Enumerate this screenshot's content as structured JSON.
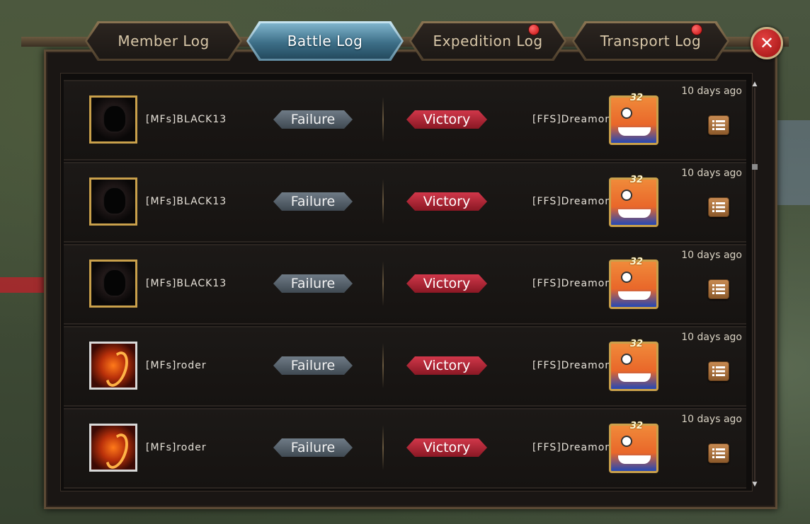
{
  "tabs": [
    {
      "label": "Member Log",
      "active": false,
      "notification": false
    },
    {
      "label": "Battle Log",
      "active": true,
      "notification": false
    },
    {
      "label": "Expedition Log",
      "active": false,
      "notification": true
    },
    {
      "label": "Transport Log",
      "active": false,
      "notification": true
    }
  ],
  "close_label": "✕",
  "colors": {
    "active_tab": "#5e8aa0",
    "victory": "#c0283b",
    "failure": "#5a646e",
    "notification": "#d61a1a"
  },
  "battles": [
    {
      "attacker": "[MFs]BLACK13",
      "attacker_icon": "skull-avatar-icon",
      "attacker_result": "Failure",
      "defender_result": "Victory",
      "defender": "[FFS]Dreamon",
      "defender_level": "32",
      "time": "10 days ago"
    },
    {
      "attacker": "[MFs]BLACK13",
      "attacker_icon": "skull-avatar-icon",
      "attacker_result": "Failure",
      "defender_result": "Victory",
      "defender": "[FFS]Dreamon",
      "defender_level": "32",
      "time": "10 days ago"
    },
    {
      "attacker": "[MFs]BLACK13",
      "attacker_icon": "skull-avatar-icon",
      "attacker_result": "Failure",
      "defender_result": "Victory",
      "defender": "[FFS]Dreamon",
      "defender_level": "32",
      "time": "10 days ago"
    },
    {
      "attacker": "[MFs]roder",
      "attacker_icon": "dragon-avatar-icon",
      "attacker_result": "Failure",
      "defender_result": "Victory",
      "defender": "[FFS]Dreamon",
      "defender_level": "32",
      "time": "10 days ago"
    },
    {
      "attacker": "[MFs]roder",
      "attacker_icon": "dragon-avatar-icon",
      "attacker_result": "Failure",
      "defender_result": "Victory",
      "defender": "[FFS]Dreamon",
      "defender_level": "32",
      "time": "10 days ago"
    }
  ],
  "icons": {
    "detail": "list-icon",
    "scroll_up": "scroll-up-arrow-icon",
    "scroll_down": "scroll-down-arrow-icon"
  }
}
